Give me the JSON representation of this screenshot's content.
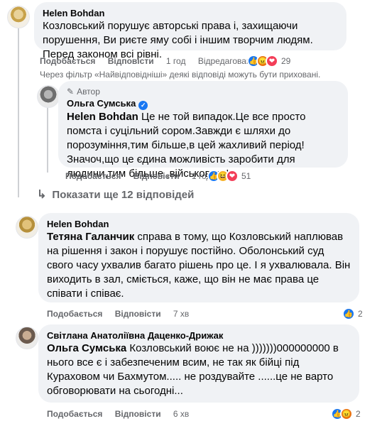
{
  "comments": [
    {
      "author": "Helen Bohdan",
      "text": "Козловський порушує авторські права і, захищаючи порушення, Ви риєте яму собі і іншим творчим людям. Перед законом всі рівні.",
      "like_label": "Подобається",
      "reply_label": "Відповісти",
      "time": "1 год",
      "edited": "Відредаговано",
      "reaction_count": "29"
    },
    {
      "author": "Ольга Сумська",
      "author_badge": "Автор",
      "mention": "Helen Bohdan",
      "text": " Це не той випадок.Це все просто помста і суцільний сором.Завжди є шляхи до порозуміння,тим більше,в цей жахливий період!Значоч,що це єдина можливість заробити для людини,тим більше ,військового!",
      "like_label": "Подобається",
      "reply_label": "Відповісти",
      "time": "1 год",
      "reaction_count": "51"
    },
    {
      "author": "Helen Bohdan",
      "mention": "Тетяна Галанчик",
      "text": " справа в тому, що Козловський наплював на рішення і закон і порушує постійно. Оболонський суд свого часу ухвалив багато рішень про це. І я ухвалювала. Він виходить в зал, сміється, каже, що він не має права це співати і співає.",
      "like_label": "Подобається",
      "reply_label": "Відповісти",
      "time": "7 хв",
      "reaction_count": "2"
    },
    {
      "author": "Світлана Анатоліївна Даценко-Дрижак",
      "mention": "Ольга Сумська",
      "text": " Козловський воює не на )))))))000000000 в нього все є і забезпеченим всим, не так як бійці під Кураховом чи Бахмутом..... не роздувайте ......це не варто обговорювати на сьогодні...",
      "like_label": "Подобається",
      "reply_label": "Відповісти",
      "time": "6 хв",
      "reaction_count": "2"
    }
  ],
  "filter_note": "Через фільтр «Найвідповідніші» деякі відповіді можуть бути приховані.",
  "more_replies": "Показати ще 12 відповідей",
  "colors": {
    "bubble": "#f0f2f5",
    "meta": "#65676b",
    "like": "#1877f2",
    "love": "#f33e58",
    "angry": "#e9710f"
  }
}
